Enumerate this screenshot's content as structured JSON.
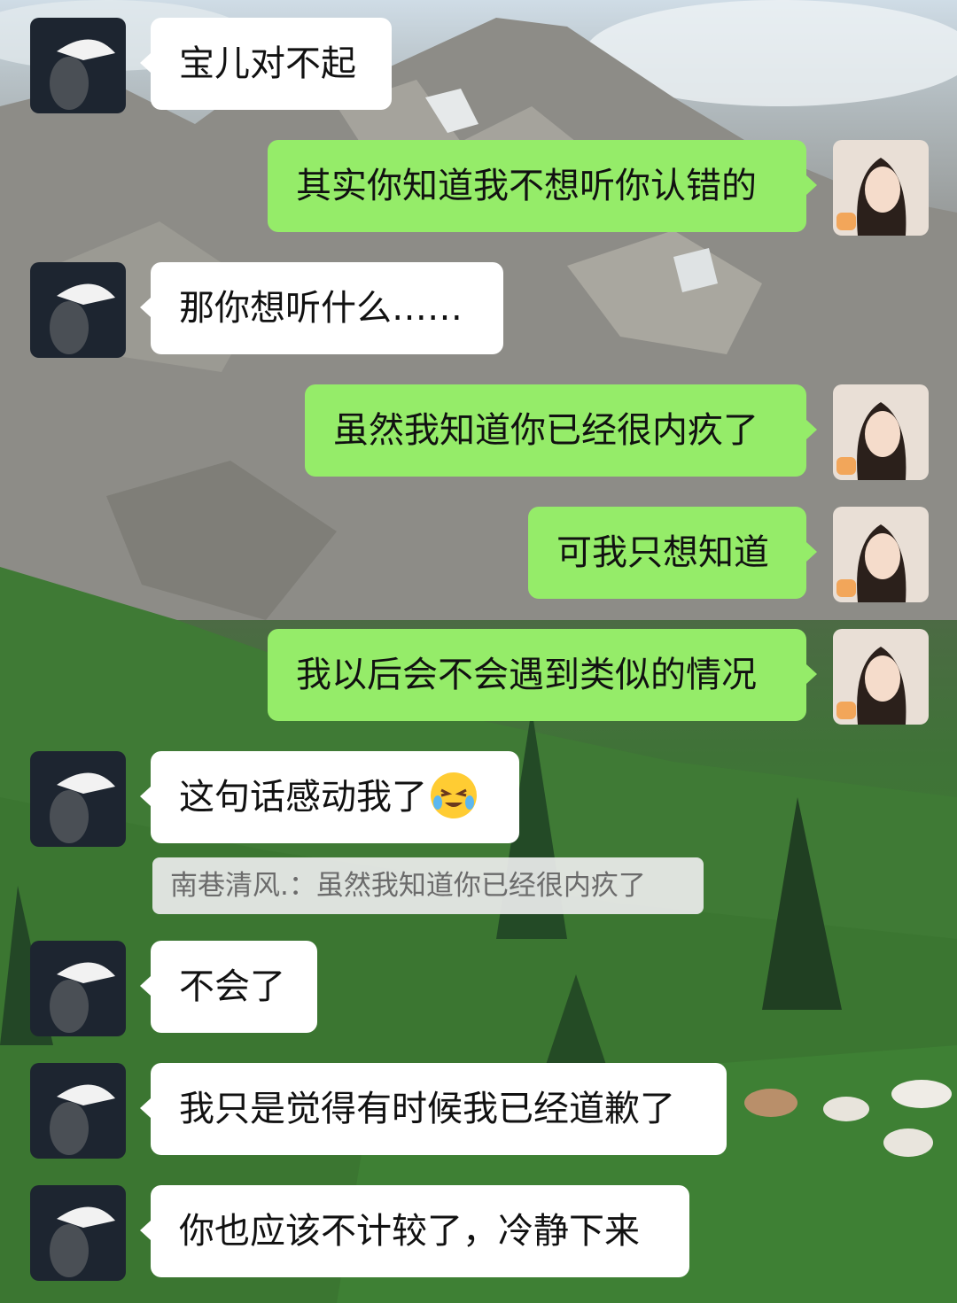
{
  "chat": {
    "messages": [
      {
        "side": "in",
        "text": "宝儿对不起"
      },
      {
        "side": "out",
        "text": "其实你知道我不想听你认错的"
      },
      {
        "side": "in",
        "text": "那你想听什么……"
      },
      {
        "side": "out",
        "text": "虽然我知道你已经很内疚了"
      },
      {
        "side": "out",
        "text": "可我只想知道"
      },
      {
        "side": "out",
        "text": "我以后会不会遇到类似的情况"
      },
      {
        "side": "in",
        "text": "这句话感动我了",
        "emoji": "crying-laughing-emoji"
      },
      {
        "side": "in",
        "text": "不会了"
      },
      {
        "side": "in",
        "text": "我只是觉得有时候我已经道歉了"
      },
      {
        "side": "in",
        "text": "你也应该不计较了，冷静下来"
      }
    ],
    "quote": {
      "author": "南巷清风.",
      "separator": "：",
      "text": "虽然我知道你已经很内疚了"
    }
  },
  "colors": {
    "outgoing_bubble": "#95ec69",
    "incoming_bubble": "#ffffff",
    "quote_background": "#ebebeb"
  }
}
